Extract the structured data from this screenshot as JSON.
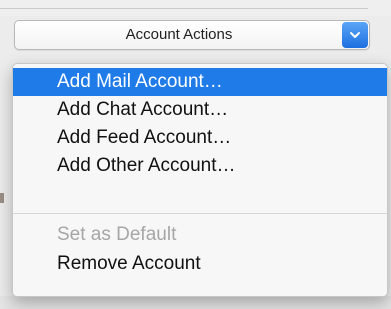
{
  "popup_button": {
    "label": "Account Actions",
    "stepper_icon": "chevron-down-icon"
  },
  "menu": {
    "items": [
      {
        "label": "Add Mail Account…",
        "state": "highlighted"
      },
      {
        "label": "Add Chat Account…",
        "state": "enabled"
      },
      {
        "label": "Add Feed Account…",
        "state": "enabled"
      },
      {
        "label": "Add Other Account…",
        "state": "enabled"
      },
      {
        "label": "Set as Default",
        "state": "disabled"
      },
      {
        "label": "Remove Account",
        "state": "enabled"
      }
    ]
  },
  "colors": {
    "highlight": "#1f7be8",
    "disabled_text": "#a6a6a6",
    "stepper": "#1d6fe0"
  }
}
